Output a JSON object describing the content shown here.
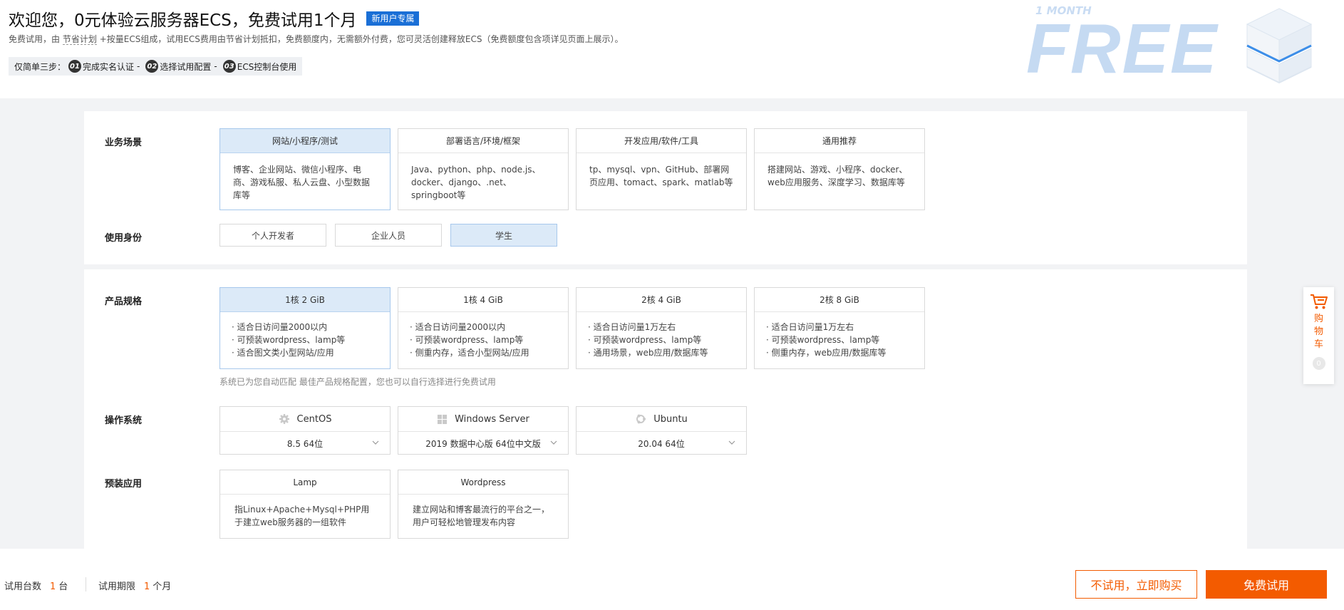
{
  "header": {
    "title": "欢迎您，0元体验云服务器ECS，免费试用1个月",
    "badge": "新用户专属",
    "subtitle_prefix": "免费试用，由",
    "subtitle_plan": "节省计划",
    "subtitle_rest": "+按量ECS组成，试用ECS费用由节省计划抵扣，免费额度内，无需额外付费，您可灵活创建释放ECS（免费额度包含项详见页面上展示）。",
    "steps_label": "仅简单三步：",
    "steps": [
      {
        "num": "01",
        "label": "完成实名认证"
      },
      {
        "num": "02",
        "label": "选择试用配置"
      },
      {
        "num": "03",
        "label": "ECS控制台使用"
      }
    ],
    "step_sep": "-",
    "promo_month": "1 MONTH",
    "promo_free": "FREE"
  },
  "scenario": {
    "label": "业务场景",
    "options": [
      {
        "title": "网站/小程序/测试",
        "desc": "博客、企业网站、微信小程序、电商、游戏私服、私人云盘、小型数据库等",
        "selected": true
      },
      {
        "title": "部署语言/环境/框架",
        "desc": "Java、python、php、node.js、docker、django、.net、springboot等",
        "selected": false
      },
      {
        "title": "开发应用/软件/工具",
        "desc": "tp、mysql、vpn、GitHub、部署网页应用、tomact、spark、matlab等",
        "selected": false
      },
      {
        "title": "通用推荐",
        "desc": "搭建网站、游戏、小程序、docker、web应用服务、深度学习、数据库等",
        "selected": false
      }
    ]
  },
  "identity": {
    "label": "使用身份",
    "options": [
      {
        "label": "个人开发者",
        "selected": false
      },
      {
        "label": "企业人员",
        "selected": false
      },
      {
        "label": "学生",
        "selected": true
      }
    ]
  },
  "spec": {
    "label": "产品规格",
    "options": [
      {
        "title": "1核 2 GiB",
        "bullets": [
          "适合日访问量2000以内",
          "可预装wordpress、lamp等",
          "适合图文类小型网站/应用"
        ],
        "selected": true
      },
      {
        "title": "1核 4 GiB",
        "bullets": [
          "适合日访问量2000以内",
          "可预装wordpress、lamp等",
          "侧重内存，适合小型网站/应用"
        ],
        "selected": false
      },
      {
        "title": "2核 4 GiB",
        "bullets": [
          "适合日访问量1万左右",
          "可预装wordpress、lamp等",
          "通用场景，web应用/数据库等"
        ],
        "selected": false
      },
      {
        "title": "2核 8 GiB",
        "bullets": [
          "适合日访问量1万左右",
          "可预装wordpress、lamp等",
          "侧重内存，web应用/数据库等"
        ],
        "selected": false
      }
    ],
    "hint": "系统已为您自动匹配 最佳产品规格配置，您也可以自行选择进行免费试用"
  },
  "os": {
    "label": "操作系统",
    "options": [
      {
        "name": "CentOS",
        "icon": "centos-icon",
        "version": "8.5 64位"
      },
      {
        "name": "Windows Server",
        "icon": "windows-icon",
        "version": "2019 数据中心版 64位中文版"
      },
      {
        "name": "Ubuntu",
        "icon": "ubuntu-icon",
        "version": "20.04 64位"
      }
    ]
  },
  "apps": {
    "label": "预装应用",
    "options": [
      {
        "title": "Lamp",
        "desc": "指Linux+Apache+Mysql+PHP用于建立web服务器的一组软件"
      },
      {
        "title": "Wordpress",
        "desc": "建立网站和博客最流行的平台之一，用户可轻松地管理发布内容"
      }
    ]
  },
  "cart": {
    "label": "购物车",
    "count": "0"
  },
  "footer": {
    "count_label": "试用台数",
    "count_value": "1",
    "count_unit": "台",
    "period_label": "试用期限",
    "period_value": "1",
    "period_unit": "个月",
    "buy_button": "不试用，立即购买",
    "trial_button": "免费试用"
  },
  "colors": {
    "accent": "#f35b00",
    "brand_blue": "#1a6fd6",
    "selected_bg": "#dceaf8"
  }
}
